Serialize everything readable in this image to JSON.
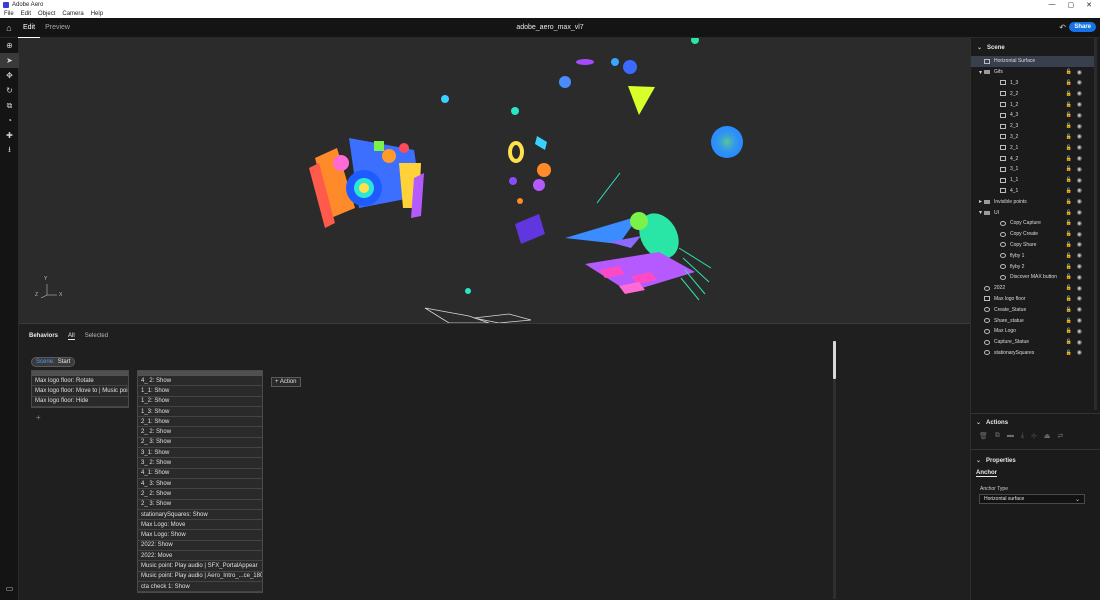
{
  "window": {
    "app_title": "Adobe Aero",
    "controls": [
      "—",
      "▢",
      "✕"
    ]
  },
  "menu": [
    "File",
    "Edit",
    "Object",
    "Camera",
    "Help"
  ],
  "header": {
    "tabs": [
      "Edit",
      "Preview"
    ],
    "doc_title": "adobe_aero_max_vl7",
    "share_label": "Share"
  },
  "tools": [
    "add-icon",
    "select-icon",
    "move-icon",
    "rotate-icon",
    "scale-icon",
    "orbit-icon",
    "pan-icon",
    "drop-icon"
  ],
  "behaviors": {
    "title": "Behaviors",
    "filter_all": "All",
    "filter_selected": "Selected",
    "trigger_key": "Scene:",
    "trigger_value": "Start",
    "track1": [
      "Max logo floor: Rotate",
      "Max logo floor: Move to | Music point",
      "Max logo floor: Hide"
    ],
    "track2": [
      "4_ 2: Show",
      "1_1: Show",
      "1_2: Show",
      "1_3: Show",
      "2_1: Show",
      "2_ 2: Show",
      "2_ 3: Show",
      "3_1: Show",
      "3_ 2: Show",
      "4_1: Show",
      "4_ 3: Show",
      "2_ 2: Show",
      "2_ 3: Show",
      "stationarySquares: Show",
      "Max Logo: Move",
      "Max Logo: Show",
      "2022: Show",
      "2022: Move",
      "Music point: Play audio | SFX_PortalAppear",
      "Music point: Play audio | Aero_Intro_...ce_1808(1)",
      "cta check 1: Show"
    ],
    "add_action": "+ Action",
    "add_trigger": "+"
  },
  "scene": {
    "title": "Scene",
    "items": [
      {
        "label": "Horizontal Surface",
        "indent": 0,
        "caret": "",
        "icon": "img",
        "selected": true,
        "lock": false
      },
      {
        "label": "Gifs",
        "indent": 0,
        "caret": "▾",
        "icon": "folder",
        "selected": false,
        "lock": true
      },
      {
        "label": "1_3",
        "indent": 2,
        "caret": "",
        "icon": "img",
        "selected": false,
        "lock": true
      },
      {
        "label": "2_2",
        "indent": 2,
        "caret": "",
        "icon": "img",
        "selected": false,
        "lock": true
      },
      {
        "label": "1_2",
        "indent": 2,
        "caret": "",
        "icon": "img",
        "selected": false,
        "lock": true
      },
      {
        "label": "4_3",
        "indent": 2,
        "caret": "",
        "icon": "img",
        "selected": false,
        "lock": true
      },
      {
        "label": "2_3",
        "indent": 2,
        "caret": "",
        "icon": "img",
        "selected": false,
        "lock": true
      },
      {
        "label": "3_2",
        "indent": 2,
        "caret": "",
        "icon": "img",
        "selected": false,
        "lock": true
      },
      {
        "label": "2_1",
        "indent": 2,
        "caret": "",
        "icon": "img",
        "selected": false,
        "lock": true
      },
      {
        "label": "4_2",
        "indent": 2,
        "caret": "",
        "icon": "img",
        "selected": false,
        "lock": true
      },
      {
        "label": "3_1",
        "indent": 2,
        "caret": "",
        "icon": "img",
        "selected": false,
        "lock": true
      },
      {
        "label": "1_1",
        "indent": 2,
        "caret": "",
        "icon": "img",
        "selected": false,
        "lock": true
      },
      {
        "label": "4_1",
        "indent": 2,
        "caret": "",
        "icon": "img",
        "selected": false,
        "lock": true
      },
      {
        "label": "Invisible points",
        "indent": 0,
        "caret": "▸",
        "icon": "folder",
        "selected": false,
        "lock": true
      },
      {
        "label": "UI",
        "indent": 0,
        "caret": "▾",
        "icon": "folder",
        "selected": false,
        "lock": true
      },
      {
        "label": "Copy Capture",
        "indent": 2,
        "caret": "",
        "icon": "round",
        "selected": false,
        "lock": true
      },
      {
        "label": "Copy Create",
        "indent": 2,
        "caret": "",
        "icon": "round",
        "selected": false,
        "lock": true
      },
      {
        "label": "Copy Share",
        "indent": 2,
        "caret": "",
        "icon": "round",
        "selected": false,
        "lock": true
      },
      {
        "label": "flyby 1",
        "indent": 2,
        "caret": "",
        "icon": "round",
        "selected": false,
        "lock": true
      },
      {
        "label": "flyby 2",
        "indent": 2,
        "caret": "",
        "icon": "round",
        "selected": false,
        "lock": true
      },
      {
        "label": "Discover MAX button",
        "indent": 2,
        "caret": "",
        "icon": "round",
        "selected": false,
        "lock": true
      },
      {
        "label": "2022",
        "indent": 0,
        "caret": "",
        "icon": "round",
        "selected": false,
        "lock": true
      },
      {
        "label": "Max logo floor",
        "indent": 0,
        "caret": "",
        "icon": "img",
        "selected": false,
        "lock": true
      },
      {
        "label": "Create_Statue",
        "indent": 0,
        "caret": "",
        "icon": "round",
        "selected": false,
        "lock": true
      },
      {
        "label": "Share_statue",
        "indent": 0,
        "caret": "",
        "icon": "round",
        "selected": false,
        "lock": true
      },
      {
        "label": "Max Logo",
        "indent": 0,
        "caret": "",
        "icon": "round",
        "selected": false,
        "lock": true
      },
      {
        "label": "Capture_Statue",
        "indent": 0,
        "caret": "",
        "icon": "round",
        "selected": false,
        "lock": true
      },
      {
        "label": "stationarySquares",
        "indent": 0,
        "caret": "",
        "icon": "round",
        "selected": false,
        "lock": true
      }
    ]
  },
  "actions": {
    "title": "Actions",
    "icons": [
      "delete-icon",
      "duplicate-icon",
      "group-icon",
      "download-icon",
      "align-icon",
      "anchor-icon",
      "replace-icon"
    ]
  },
  "properties": {
    "title": "Properties",
    "anchor_tab": "Anchor",
    "anchor_type_label": "Anchor Type",
    "anchor_type_value": "Horizontal surface"
  },
  "viewport": {
    "axis_y": "Y",
    "axis_z": "Z",
    "axis_x": "X"
  }
}
